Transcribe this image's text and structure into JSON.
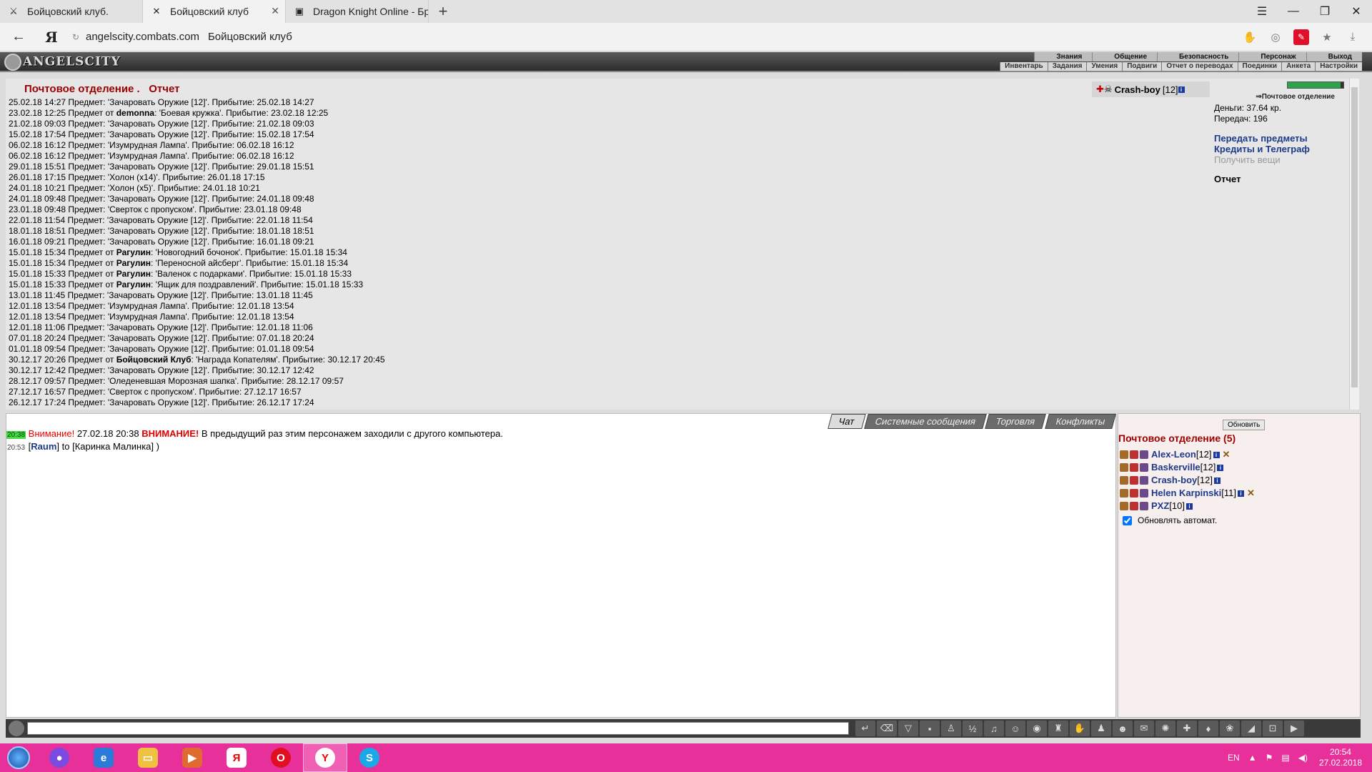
{
  "browser": {
    "tabs": [
      {
        "title": "Бойцовский клуб.",
        "active": false
      },
      {
        "title": "Бойцовский клуб",
        "active": true
      },
      {
        "title": "Dragon Knight Online - Бра",
        "active": false
      }
    ],
    "url_domain": "angelscity.combats.com",
    "url_title": "Бойцовский клуб"
  },
  "game": {
    "logo": "ANGELSCITY",
    "top_menu": [
      "Знания",
      "Общение",
      "Безопасность",
      "Персонаж",
      "Выход"
    ],
    "sub_menu": [
      "Инвентарь",
      "Задания",
      "Умения",
      "Подвиги",
      "Отчет о переводах",
      "Поединки",
      "Анкета",
      "Настройки"
    ]
  },
  "post": {
    "title": "Почтовое отделение .",
    "subtitle": "Отчет",
    "player_name": "Crash-boy",
    "player_level": "[12]",
    "location": "Почтовое отделение",
    "money": "Деньги: 37.64 кр.",
    "transfers": "Передач: 196",
    "hp_fraction": 0.95,
    "links": {
      "transfer": "Передать предметы",
      "credits": "Кредиты и Телеграф",
      "get_items": "Получить вещи",
      "report": "Отчет"
    },
    "log": [
      {
        "pre": "25.02.18 14:27 Предмет: ",
        "who": "",
        "post": "'Зачаровать Оружие [12]'. Прибытие: 25.02.18 14:27"
      },
      {
        "pre": "23.02.18 12:25 Предмет от ",
        "who": "demonna",
        "post": ": 'Боевая кружка'. Прибытие: 23.02.18 12:25"
      },
      {
        "pre": "21.02.18 09:03 Предмет: ",
        "who": "",
        "post": "'Зачаровать Оружие [12]'. Прибытие: 21.02.18 09:03"
      },
      {
        "pre": "15.02.18 17:54 Предмет: ",
        "who": "",
        "post": "'Зачаровать Оружие [12]'. Прибытие: 15.02.18 17:54"
      },
      {
        "pre": "06.02.18 16:12 Предмет: ",
        "who": "",
        "post": "'Изумрудная Лампа'. Прибытие: 06.02.18 16:12"
      },
      {
        "pre": "06.02.18 16:12 Предмет: ",
        "who": "",
        "post": "'Изумрудная Лампа'. Прибытие: 06.02.18 16:12"
      },
      {
        "pre": "29.01.18 15:51 Предмет: ",
        "who": "",
        "post": "'Зачаровать Оружие [12]'. Прибытие: 29.01.18 15:51"
      },
      {
        "pre": "26.01.18 17:15 Предмет: ",
        "who": "",
        "post": "'Холон (x14)'. Прибытие: 26.01.18 17:15"
      },
      {
        "pre": "24.01.18 10:21 Предмет: ",
        "who": "",
        "post": "'Холон (x5)'. Прибытие: 24.01.18 10:21"
      },
      {
        "pre": "24.01.18 09:48 Предмет: ",
        "who": "",
        "post": "'Зачаровать Оружие [12]'. Прибытие: 24.01.18 09:48"
      },
      {
        "pre": "23.01.18 09:48 Предмет: ",
        "who": "",
        "post": "'Сверток с пропуском'. Прибытие: 23.01.18 09:48"
      },
      {
        "pre": "22.01.18 11:54 Предмет: ",
        "who": "",
        "post": "'Зачаровать Оружие [12]'. Прибытие: 22.01.18 11:54"
      },
      {
        "pre": "18.01.18 18:51 Предмет: ",
        "who": "",
        "post": "'Зачаровать Оружие [12]'. Прибытие: 18.01.18 18:51"
      },
      {
        "pre": "16.01.18 09:21 Предмет: ",
        "who": "",
        "post": "'Зачаровать Оружие [12]'. Прибытие: 16.01.18 09:21"
      },
      {
        "pre": "15.01.18 15:34 Предмет от ",
        "who": "Рагулин",
        "post": ": 'Новогодний бочонок'. Прибытие: 15.01.18 15:34"
      },
      {
        "pre": "15.01.18 15:34 Предмет от ",
        "who": "Рагулин",
        "post": ": 'Переносной айсберг'. Прибытие: 15.01.18 15:34"
      },
      {
        "pre": "15.01.18 15:33 Предмет от ",
        "who": "Рагулин",
        "post": ": 'Валенок с подарками'. Прибытие: 15.01.18 15:33"
      },
      {
        "pre": "15.01.18 15:33 Предмет от ",
        "who": "Рагулин",
        "post": ": 'Ящик для поздравлений'. Прибытие: 15.01.18 15:33"
      },
      {
        "pre": "13.01.18 11:45 Предмет: ",
        "who": "",
        "post": "'Зачаровать Оружие [12]'. Прибытие: 13.01.18 11:45"
      },
      {
        "pre": "12.01.18 13:54 Предмет: ",
        "who": "",
        "post": "'Изумрудная Лампа'. Прибытие: 12.01.18 13:54"
      },
      {
        "pre": "12.01.18 13:54 Предмет: ",
        "who": "",
        "post": "'Изумрудная Лампа'. Прибытие: 12.01.18 13:54"
      },
      {
        "pre": "12.01.18 11:06 Предмет: ",
        "who": "",
        "post": "'Зачаровать Оружие [12]'. Прибытие: 12.01.18 11:06"
      },
      {
        "pre": "07.01.18 20:24 Предмет: ",
        "who": "",
        "post": "'Зачаровать Оружие [12]'. Прибытие: 07.01.18 20:24"
      },
      {
        "pre": "01.01.18 09:54 Предмет: ",
        "who": "",
        "post": "'Зачаровать Оружие [12]'. Прибытие: 01.01.18 09:54"
      },
      {
        "pre": "30.12.17 20:26 Предмет от ",
        "who": "Бойцовский Клуб",
        "post": ": 'Награда Копателям'. Прибытие: 30.12.17 20:45"
      },
      {
        "pre": "30.12.17 12:42 Предмет: ",
        "who": "",
        "post": "'Зачаровать Оружие [12]'. Прибытие: 30.12.17 12:42"
      },
      {
        "pre": "28.12.17 09:57 Предмет: ",
        "who": "",
        "post": "'Оледеневшая Морозная шапка'. Прибытие: 28.12.17 09:57"
      },
      {
        "pre": "27.12.17 16:57 Предмет: ",
        "who": "",
        "post": "'Сверток с пропуском'. Прибытие: 27.12.17 16:57"
      },
      {
        "pre": "26.12.17 17:24 Предмет: ",
        "who": "",
        "post": "'Зачаровать Оружие [12]'. Прибытие: 26.12.17 17:24"
      }
    ]
  },
  "chat": {
    "tabs": [
      "Чат",
      "Системные сообщения",
      "Торговля",
      "Конфликты"
    ],
    "messages": [
      {
        "time": "20:38",
        "warn": "Внимание!",
        "date": " 27.02.18 20:38 ",
        "bold": "ВНИМАНИЕ!",
        "text": " В предыдущий раз этим персонажем заходили с другого компьютера."
      },
      {
        "time": "20:53",
        "from": "Raum",
        "text": "to [Каринка Малинка] )"
      }
    ]
  },
  "online": {
    "refresh": "Обновить",
    "title": "Почтовое отделение (5)",
    "users": [
      {
        "name": "Alex-Leon",
        "level": "[12]",
        "x": true
      },
      {
        "name": "Baskerville",
        "level": "[12]",
        "x": false
      },
      {
        "name": "Crash-boy",
        "level": "[12]",
        "x": false
      },
      {
        "name": "Helen Karpinski",
        "level": "[11]",
        "x": true
      },
      {
        "name": "PXZ",
        "level": "[10]",
        "x": false
      }
    ],
    "auto_refresh": "Обновлять автомат."
  },
  "taskbar": {
    "lang": "EN",
    "time": "20:54",
    "date": "27.02.2018"
  },
  "colors": {
    "title_red": "#9b0000",
    "link_blue": "#1d3a8a",
    "taskbar": "#e8309a"
  }
}
